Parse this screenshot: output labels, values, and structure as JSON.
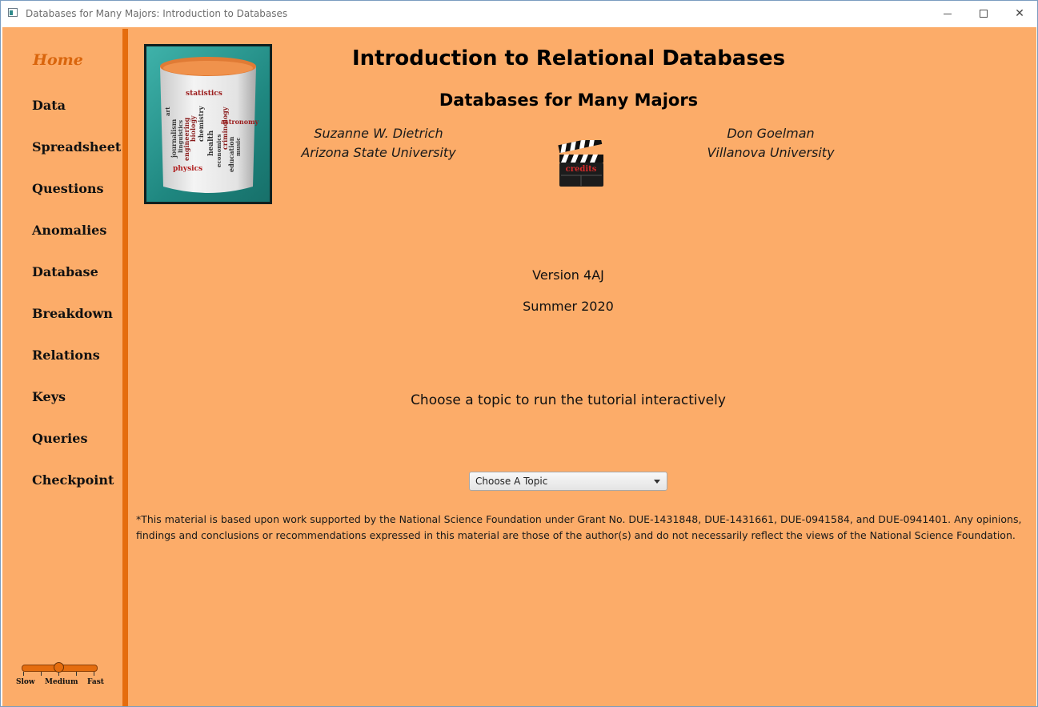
{
  "window": {
    "title": "Databases for Many Majors: Introduction to Databases",
    "minimize_symbol": "minimize-icon",
    "maximize_symbol": "maximize-icon",
    "close_symbol": "✕"
  },
  "sidebar": {
    "items": [
      {
        "label": "Home",
        "active": true
      },
      {
        "label": "Data"
      },
      {
        "label": "Spreadsheet"
      },
      {
        "label": "Questions"
      },
      {
        "label": "Anomalies"
      },
      {
        "label": "Database"
      },
      {
        "label": "Breakdown"
      },
      {
        "label": "Relations"
      },
      {
        "label": "Keys"
      },
      {
        "label": "Queries"
      },
      {
        "label": "Checkpoint"
      }
    ],
    "speed": {
      "labels": [
        "Slow",
        "Medium",
        "Fast"
      ],
      "value": "Medium"
    }
  },
  "header": {
    "title": "Introduction to Relational Databases",
    "subtitle": "Databases for Many Majors"
  },
  "logo": {
    "words": [
      "statistics",
      "journalism",
      "linguistics",
      "engineering",
      "biology",
      "chemistry",
      "physics",
      "health",
      "economics",
      "criminology",
      "astronomy",
      "education",
      "music",
      "art"
    ]
  },
  "authors": [
    {
      "name": "Suzanne W. Dietrich",
      "affiliation": "Arizona State University"
    },
    {
      "name": "Don Goelman",
      "affiliation": "Villanova University"
    }
  ],
  "credits_label": "credits",
  "version": "Version 4AJ",
  "season": "Summer 2020",
  "instruction": "Choose a topic to run the tutorial interactively",
  "topic_select": {
    "value": "Choose A Topic"
  },
  "footnote": "*This material is based upon work supported by the National Science Foundation under Grant No. DUE-1431848, DUE-1431661, DUE-0941584,  and DUE-0941401. Any opinions, findings and conclusions or recommendations expressed in this material are those of the author(s) and do not necessarily reflect the views of the National Science Foundation.",
  "colors": {
    "background": "#fcac69",
    "accent": "#e56d0e",
    "home_text": "#d9650c"
  }
}
